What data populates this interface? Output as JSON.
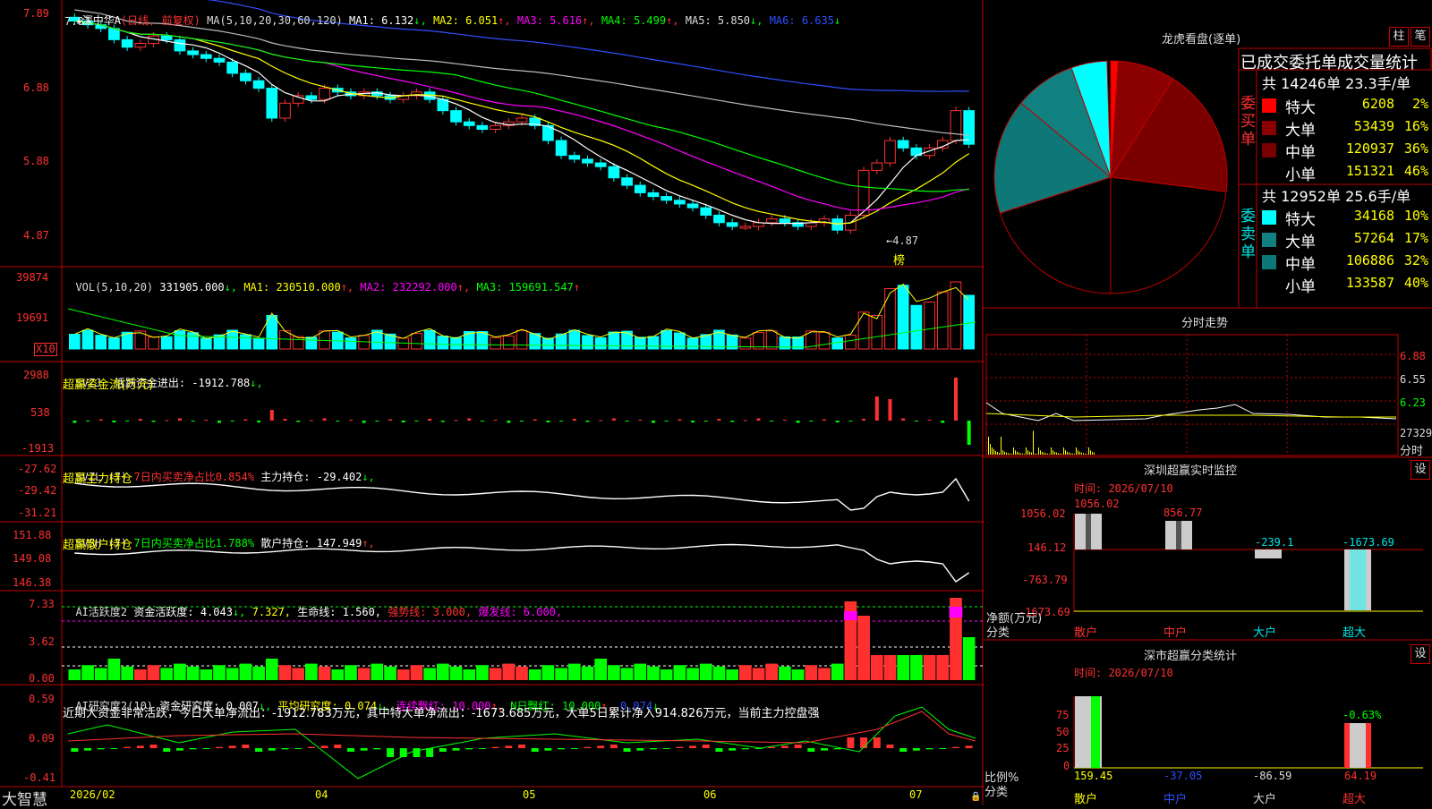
{
  "stock": {
    "name": "深中华A",
    "period": "(日线, 前复权)"
  },
  "ma": {
    "header": "MA(5,10,20,30,60,120)",
    "items": [
      {
        "label": "MA1: 6.132",
        "arrow": "↓",
        "color": "#ffffff"
      },
      {
        "label": "MA2: 6.051",
        "arrow": "↑",
        "color": "#ffff00"
      },
      {
        "label": "MA3: 5.616",
        "arrow": "↑",
        "color": "#ff00ff"
      },
      {
        "label": "MA4: 5.499",
        "arrow": "↑",
        "color": "#00ff00"
      },
      {
        "label": "MA5: 5.850",
        "arrow": "↓",
        "color": "#dddddd"
      },
      {
        "label": "MA6: 6.635",
        "arrow": "↓",
        "color": "#3050ff"
      }
    ]
  },
  "price_axis": [
    "7.89",
    "6.88",
    "5.88",
    "4.87"
  ],
  "price_annot": {
    "high": "7.87",
    "low": "←4.87",
    "bang": "榜"
  },
  "vol": {
    "header": "VOL(5,10,20)",
    "items": [
      {
        "label": "331905.000",
        "arrow": "↓",
        "color": "#ffffff"
      },
      {
        "label": "MA1: 230510.000",
        "arrow": "↑",
        "color": "#ffff00"
      },
      {
        "label": "MA2: 232292.000",
        "arrow": "↑",
        "color": "#ff00ff"
      },
      {
        "label": "MA3: 159691.547",
        "arrow": "↑",
        "color": "#00ff00"
      }
    ],
    "axis": [
      "39874",
      "19691"
    ],
    "unit": "X10"
  },
  "svzj": {
    "header": "SVZJ",
    "label": "活跃资金进出: -1912.788",
    "arrow": "↓,",
    "sub": "超赢资金流(万元)",
    "axis": [
      "2988",
      "538",
      "-1913"
    ]
  },
  "svzl": {
    "header": "SVZL (7)",
    "ratio": "7日内买卖净占比0.854%",
    "label": "主力持仓: -29.402",
    "arrow": "↓,",
    "sub": "超赢主力持仓",
    "axis": [
      "-27.62",
      "-29.42",
      "-31.21"
    ]
  },
  "svsh": {
    "header": "SVSH (7)",
    "ratio": "7日内买卖净占比1.788%",
    "label": "散户持仓: 147.949",
    "arrow": "↑,",
    "sub": "超赢散户持仓",
    "axis": [
      "151.88",
      "149.08",
      "146.38"
    ]
  },
  "ai_act": {
    "header": "AI活跃度2",
    "label1": "资金活跃度: 4.043",
    "arrow1": "↓,",
    "label2": "7.327,",
    "label3": "生命线: 1.560,",
    "label4": "强势线: 3.000,",
    "label5": "爆发线: 6.000,",
    "axis": [
      "7.33",
      "3.62",
      "0.00"
    ]
  },
  "ai_res": {
    "header": "AI研究度2(10)",
    "label1": "资金研究度: 0.007",
    "arrow1": "↓,",
    "label2": "平均研究度: 0.074",
    "arrow2": "↓,",
    "label3": "连续飘红: 10.000",
    "arrow3": "↑,",
    "label4": "N日飘红: 10.000",
    "arrow4": "↑,",
    "label5": "0.074",
    "arrow5": "↓",
    "desc": "近期大资金非常活跃，今日大单净流出：-1912.783万元，其中特大单净流出：-1673.685万元，大单5日累计净入914.826万元，当前主力控盘强",
    "axis": [
      "0.59",
      "0.09",
      "-0.41"
    ]
  },
  "dates": [
    "2026/02",
    "04",
    "05",
    "06",
    "07"
  ],
  "brand": "大智慧",
  "lhb": {
    "title": "龙虎看盘(逐单)",
    "btn1": "柱",
    "btn2": "笔",
    "subtitle": "已成交委托单成交量统计",
    "buy_label": "委买单",
    "sell_label": "委卖单",
    "buy_total": "共 14246单 23.3手/单",
    "sell_total": "共 12952单 25.6手/单",
    "buy_rows": [
      {
        "name": "特大",
        "vol": "6208",
        "pct": "2%",
        "color": "#ff0000"
      },
      {
        "name": "大单",
        "vol": "53439",
        "pct": "16%",
        "color": "#8b0000"
      },
      {
        "name": "中单",
        "vol": "120937",
        "pct": "36%",
        "color": "#7a0000"
      },
      {
        "name": "小单",
        "vol": "151321",
        "pct": "46%",
        "color": "#000000"
      }
    ],
    "sell_rows": [
      {
        "name": "特大",
        "vol": "34168",
        "pct": "10%",
        "color": "#00ffff"
      },
      {
        "name": "大单",
        "vol": "57264",
        "pct": "17%",
        "color": "#108080"
      },
      {
        "name": "中单",
        "vol": "106886",
        "pct": "32%",
        "color": "#0e7777"
      },
      {
        "name": "小单",
        "vol": "133587",
        "pct": "40%",
        "color": "#000000"
      }
    ]
  },
  "intraday": {
    "title": "分时走势",
    "axis": [
      "6.88",
      "6.55",
      "6.23",
      "27329"
    ],
    "unit": "分时"
  },
  "sz_monitor": {
    "title": "深圳超赢实时监控",
    "set": "设",
    "time": "时间: 2026/07/10",
    "axis": [
      "1056.02",
      "146.12",
      "-763.79",
      "-1673.69"
    ],
    "ylabel1": "净额(万元)",
    "ylabel2": "分类",
    "cats": [
      "散户",
      "中户",
      "大户",
      "超大"
    ],
    "values": [
      "1056.02",
      "856.77",
      "-239.1",
      "-1673.69"
    ]
  },
  "sz_stat": {
    "title": "深市超赢分类统计",
    "set": "设",
    "time": "时间: 2026/07/10",
    "axis": [
      "75",
      "50",
      "25",
      "0"
    ],
    "ylabel1": "比例%",
    "ylabel2": "分类",
    "cats": [
      "散户",
      "中户",
      "大户",
      "超大"
    ],
    "values": [
      "159.45",
      "-37.05",
      "-86.59",
      "64.19"
    ],
    "top_value": "-0.63%"
  },
  "chart_data": {
    "type": "candlestick",
    "title": "深中华A (日线, 前复权)",
    "price_ylim": [
      4.87,
      7.89
    ],
    "series_note": "daily candles Feb–Jul 2026, read approximately from chart",
    "closes_approx": [
      7.8,
      7.75,
      7.7,
      7.55,
      7.45,
      7.5,
      7.6,
      7.55,
      7.4,
      7.35,
      7.3,
      7.25,
      7.1,
      7.0,
      6.9,
      6.5,
      6.7,
      6.8,
      6.75,
      6.9,
      6.85,
      6.8,
      6.85,
      6.8,
      6.75,
      6.8,
      6.85,
      6.75,
      6.6,
      6.45,
      6.4,
      6.35,
      6.4,
      6.45,
      6.5,
      6.4,
      6.2,
      6.0,
      5.95,
      5.9,
      5.85,
      5.7,
      5.6,
      5.5,
      5.45,
      5.4,
      5.35,
      5.3,
      5.2,
      5.1,
      5.05,
      5.05,
      5.1,
      5.15,
      5.1,
      5.05,
      5.1,
      5.15,
      5.0,
      5.2,
      5.8,
      5.9,
      6.2,
      6.1,
      6.0,
      6.1,
      6.2,
      6.6,
      6.15
    ]
  }
}
